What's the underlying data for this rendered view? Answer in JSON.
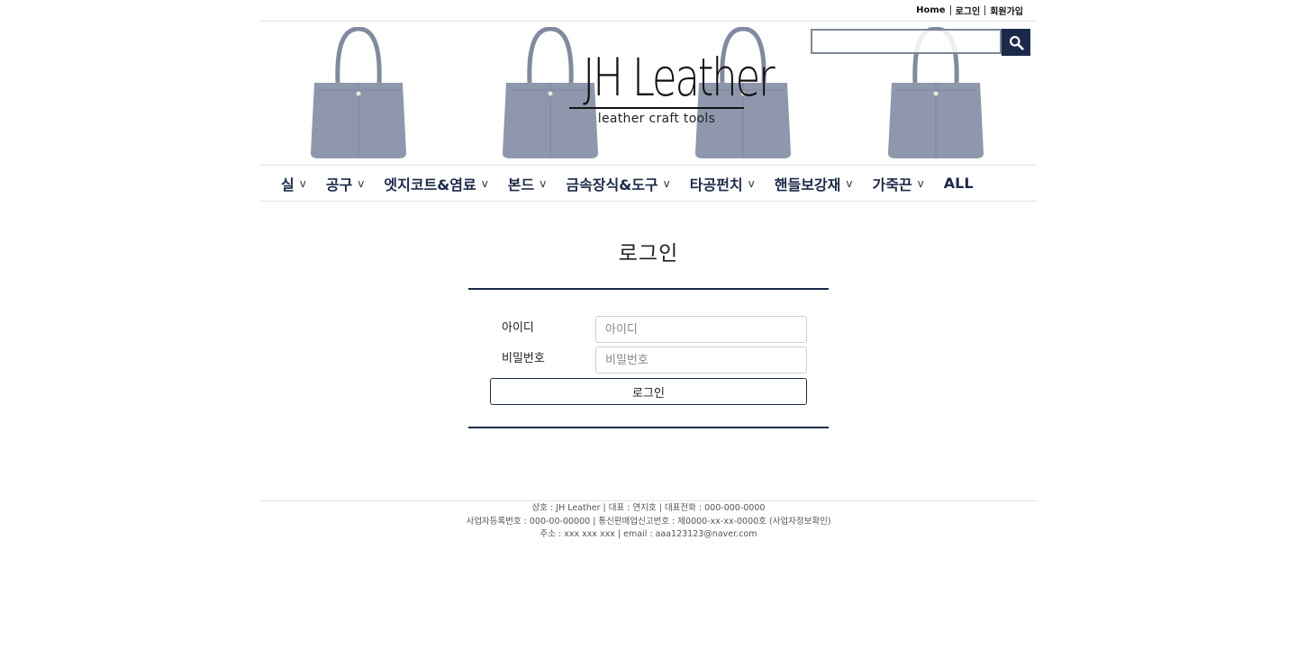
{
  "toplinks": {
    "home": "Home",
    "login": "로그인",
    "signup": "회원가입"
  },
  "logo": {
    "main": "JH Leather",
    "sub": "leather craft tools"
  },
  "search": {
    "placeholder": "",
    "icon": "search-icon"
  },
  "colors": {
    "navy": "#1b2a4a",
    "bag": "#5e6a86"
  },
  "nav": [
    {
      "label": "실",
      "chevron": "v"
    },
    {
      "label": "공구",
      "chevron": "v"
    },
    {
      "label": "엣지코트&염료",
      "chevron": "v"
    },
    {
      "label": "본드",
      "chevron": "v"
    },
    {
      "label": "금속장식&도구",
      "chevron": "v"
    },
    {
      "label": "타공펀치",
      "chevron": "v"
    },
    {
      "label": "핸들보강재",
      "chevron": "v"
    },
    {
      "label": "가죽끈",
      "chevron": "v"
    },
    {
      "label": "ALL"
    }
  ],
  "login": {
    "title": "로그인",
    "id_label": "아이디",
    "id_placeholder": "아이디",
    "pw_label": "비밀번호",
    "pw_placeholder": "비밀번호",
    "button": "로그인"
  },
  "footer": {
    "line1": "상호 : JH Leather | 대표 : 연지호 | 대표전화 : 000-000-0000",
    "line2": "사업자등록번호 : 000-00-00000 | 통신판매업신고번호 : 제0000-xx-xx-0000호 (사업자정보확인)",
    "line3": "주소 : xxx xxx xxx | email : aaa123123@naver.com"
  }
}
